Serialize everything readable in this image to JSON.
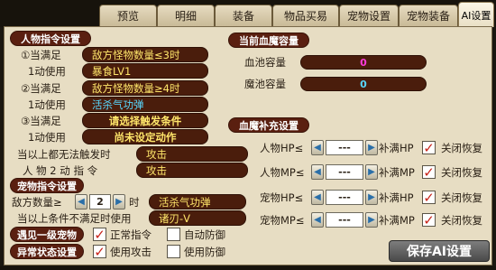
{
  "tabs": [
    {
      "label": "预览"
    },
    {
      "label": "明细"
    },
    {
      "label": "装备"
    },
    {
      "label": "物品买易"
    },
    {
      "label": "宠物设置"
    },
    {
      "label": "宠物装备"
    },
    {
      "label": "AI设置"
    }
  ],
  "player": {
    "header": "人物指令设置",
    "rules": [
      {
        "cond_label": "①当满足",
        "cond_value": "敌方怪物数量≤3时",
        "use_label": "1动使用",
        "use_value": "暴食LV1"
      },
      {
        "cond_label": "②当满足",
        "cond_value": "敌方怪物数量≥4时",
        "use_label": "1动使用",
        "use_value": "活杀气功弹"
      },
      {
        "cond_label": "③当满足",
        "cond_value": "请选择触发条件",
        "use_label": "1动使用",
        "use_value": "尚未设定动作"
      }
    ],
    "fallback_label": "当以上都无法触发时",
    "fallback_value": "攻击",
    "action2_label": "人 物 2 动 指 令",
    "action2_value": "攻击"
  },
  "pet": {
    "header": "宠物指令设置",
    "enemy_count_label": "敌方数量≥",
    "enemy_count_value": "2",
    "time_label": "时",
    "time_value": "活杀气功弹",
    "else_label": "当以上条件不满足时使用",
    "else_value": "诸刃-V"
  },
  "encounter": {
    "label": "遇见一级宠物",
    "opt1": "正常指令",
    "opt2": "自动防御"
  },
  "abnormal": {
    "label": "异常状态设置",
    "opt1": "使用攻击",
    "opt2": "使用防御"
  },
  "capacity": {
    "header": "当前血魔容量",
    "hp_label": "血池容量",
    "hp_value": "0",
    "mp_label": "魔池容量",
    "mp_value": "0"
  },
  "refill": {
    "header": "血魔补充设置",
    "rows": [
      {
        "left": "人物HP≤",
        "value": "---",
        "right": "补满HP",
        "close": "关闭恢复"
      },
      {
        "left": "人物MP≤",
        "value": "---",
        "right": "补满MP",
        "close": "关闭恢复"
      },
      {
        "left": "宠物HP≤",
        "value": "---",
        "right": "补满HP",
        "close": "关闭恢复"
      },
      {
        "left": "宠物MP≤",
        "value": "---",
        "right": "补满MP",
        "close": "关闭恢复"
      }
    ]
  },
  "save_label": "保存AI设置",
  "colors": {
    "header_pill": "#5a1f10",
    "slot_bg": "#4a1d0c",
    "slot_text": "#ffe66a",
    "cyan_text": "#58d8ff",
    "hp_value_color": "#ff3bdc",
    "mp_value_color": "#58d8ff",
    "check_color": "#c8241a",
    "panel_bg": "#e7ddc3"
  },
  "icons": {
    "arrow_left": "triangle-left-icon",
    "arrow_right": "triangle-right-icon",
    "check": "red-checkmark-icon"
  }
}
